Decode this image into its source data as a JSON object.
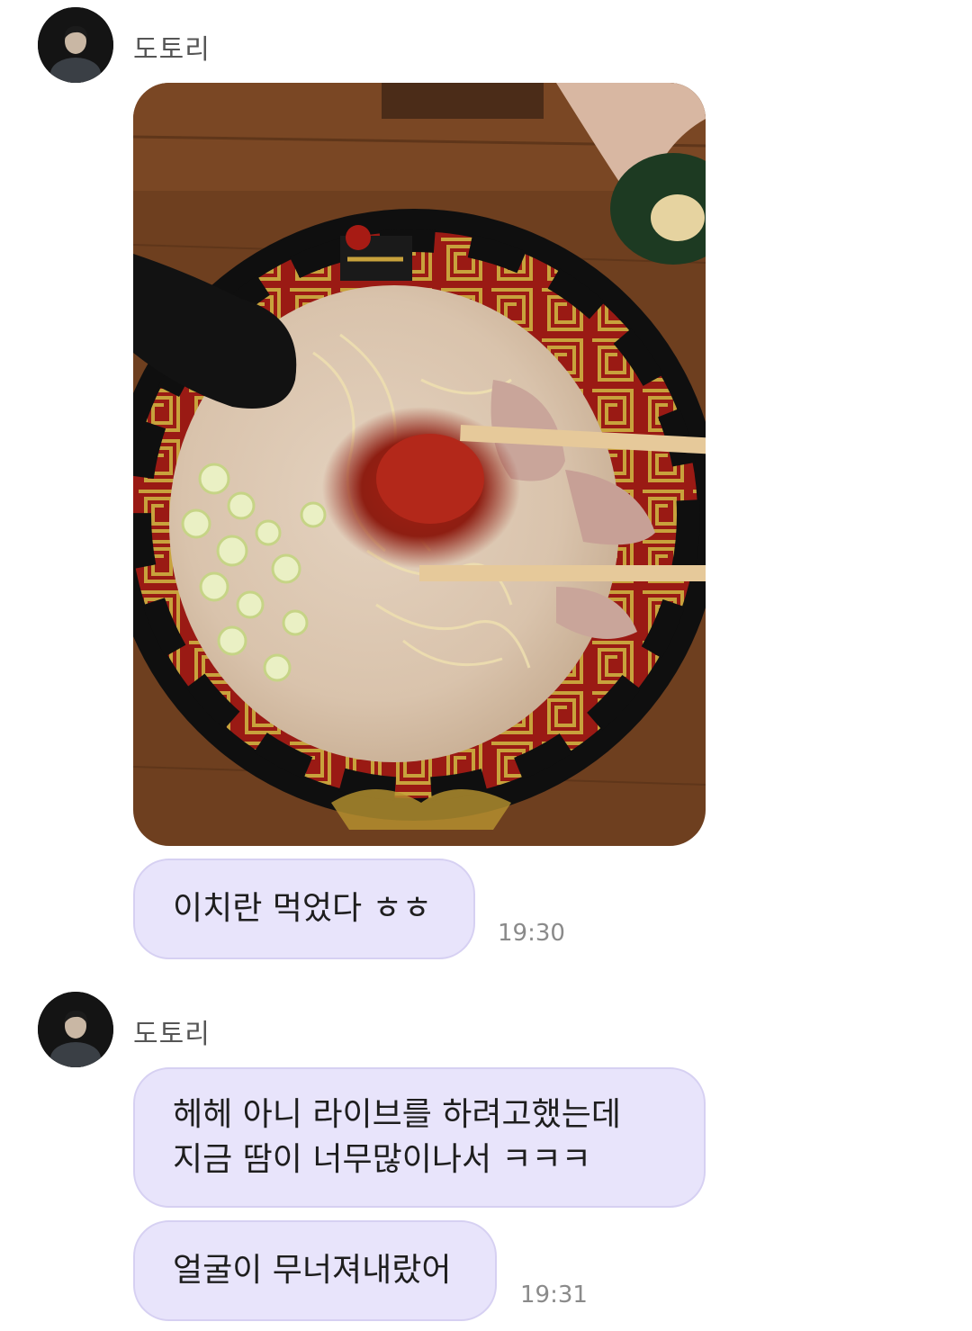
{
  "messages": [
    {
      "sender": "도토리",
      "photo": {
        "description": "ramen-bowl-photo"
      },
      "bubbles": [
        {
          "lines": [
            "이치란 먹었다 ㅎㅎ"
          ],
          "time": "19:30"
        }
      ]
    },
    {
      "sender": "도토리",
      "bubbles": [
        {
          "lines": [
            "헤헤 아니 라이브를 하려고했는데",
            "지금 땀이 너무많이나서 ㅋㅋㅋ"
          ],
          "time": ""
        },
        {
          "lines": [
            "얼굴이 무너져내랐어"
          ],
          "time": "19:31"
        }
      ]
    }
  ],
  "colors": {
    "bubble_bg": "#e8e4fb",
    "bubble_border": "#d6d0f2",
    "text": "#1e1e1e",
    "timestamp": "#8a8a8a",
    "sender_name": "#555555"
  }
}
